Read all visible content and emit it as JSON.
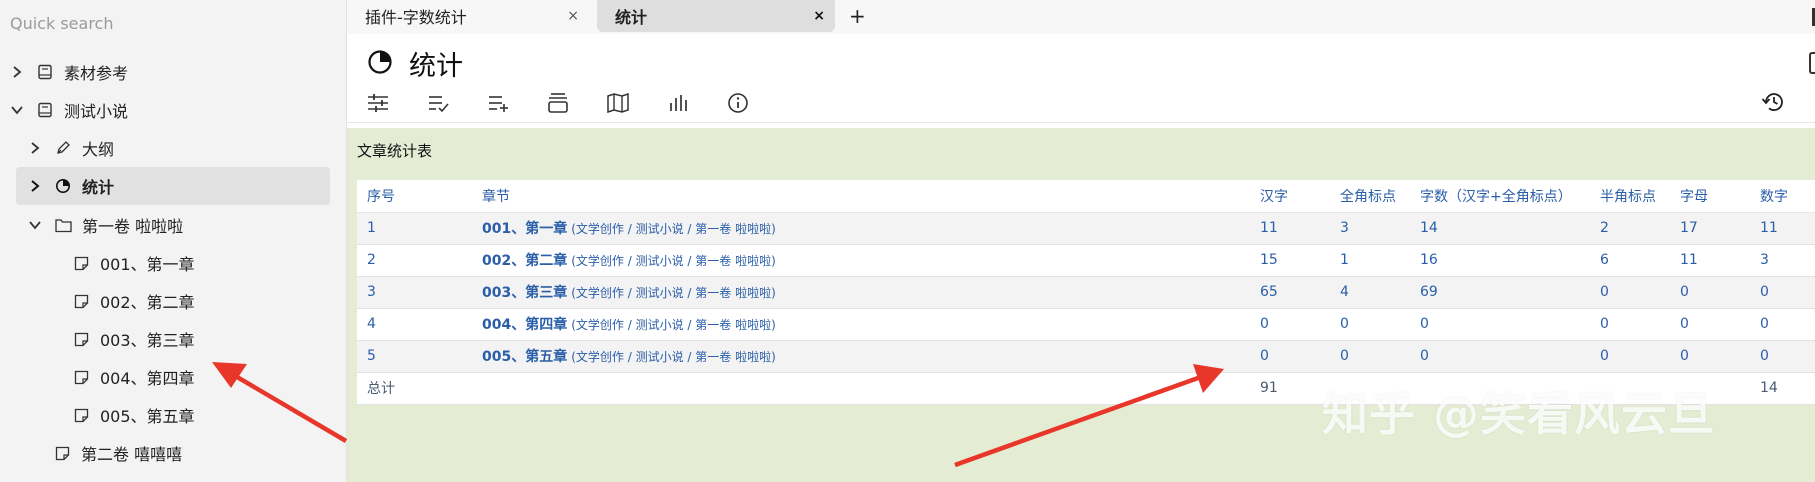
{
  "sidebar": {
    "search_placeholder": "Quick search",
    "items": [
      {
        "label": "素材参考"
      },
      {
        "label": "测试小说"
      },
      {
        "label": "大纲"
      },
      {
        "label": "统计"
      },
      {
        "label": "第一卷 啦啦啦"
      },
      {
        "label": "001、第一章"
      },
      {
        "label": "002、第二章"
      },
      {
        "label": "003、第三章"
      },
      {
        "label": "004、第四章"
      },
      {
        "label": "005、第五章"
      },
      {
        "label": "第二卷 嘻嘻嘻"
      }
    ]
  },
  "tabs": [
    {
      "label": "插件-字数统计",
      "close": "×"
    },
    {
      "label": "统计",
      "close": "×"
    }
  ],
  "new_tab": "+",
  "page": {
    "title": "统计",
    "section_title": "文章统计表"
  },
  "toolbar_icons": [
    "sliders-icon",
    "list-check-icon",
    "list-add-icon",
    "stack-icon",
    "map-icon",
    "bar-chart-icon",
    "info-icon"
  ],
  "table": {
    "headers": [
      "序号",
      "章节",
      "汉字",
      "全角标点",
      "字数（汉字+全角标点）",
      "半角标点",
      "字母",
      "数字"
    ],
    "rows": [
      {
        "no": "1",
        "chapter": "001、第一章",
        "path": "(文学创作 / 测试小说 / 第一卷 啦啦啦)",
        "hanzi": "11",
        "quanjiao": "3",
        "zishu": "14",
        "banjiao": "2",
        "zimu": "17",
        "shuzi": "11"
      },
      {
        "no": "2",
        "chapter": "002、第二章",
        "path": "(文学创作 / 测试小说 / 第一卷 啦啦啦)",
        "hanzi": "15",
        "quanjiao": "1",
        "zishu": "16",
        "banjiao": "6",
        "zimu": "11",
        "shuzi": "3"
      },
      {
        "no": "3",
        "chapter": "003、第三章",
        "path": "(文学创作 / 测试小说 / 第一卷 啦啦啦)",
        "hanzi": "65",
        "quanjiao": "4",
        "zishu": "69",
        "banjiao": "0",
        "zimu": "0",
        "shuzi": "0"
      },
      {
        "no": "4",
        "chapter": "004、第四章",
        "path": "(文学创作 / 测试小说 / 第一卷 啦啦啦)",
        "hanzi": "0",
        "quanjiao": "0",
        "zishu": "0",
        "banjiao": "0",
        "zimu": "0",
        "shuzi": "0"
      },
      {
        "no": "5",
        "chapter": "005、第五章",
        "path": "(文学创作 / 测试小说 / 第一卷 啦啦啦)",
        "hanzi": "0",
        "quanjiao": "0",
        "zishu": "0",
        "banjiao": "0",
        "zimu": "0",
        "shuzi": "0"
      }
    ],
    "total": {
      "label": "总计",
      "hanzi": "91",
      "shuzi": "14"
    }
  },
  "watermark": "知乎 @笑看风云旦",
  "colors": {
    "accent": "#2a5ea8",
    "content_bg": "#e4ecd3",
    "sidebar_bg": "#f3f3f3",
    "arrow": "#e8372a"
  }
}
